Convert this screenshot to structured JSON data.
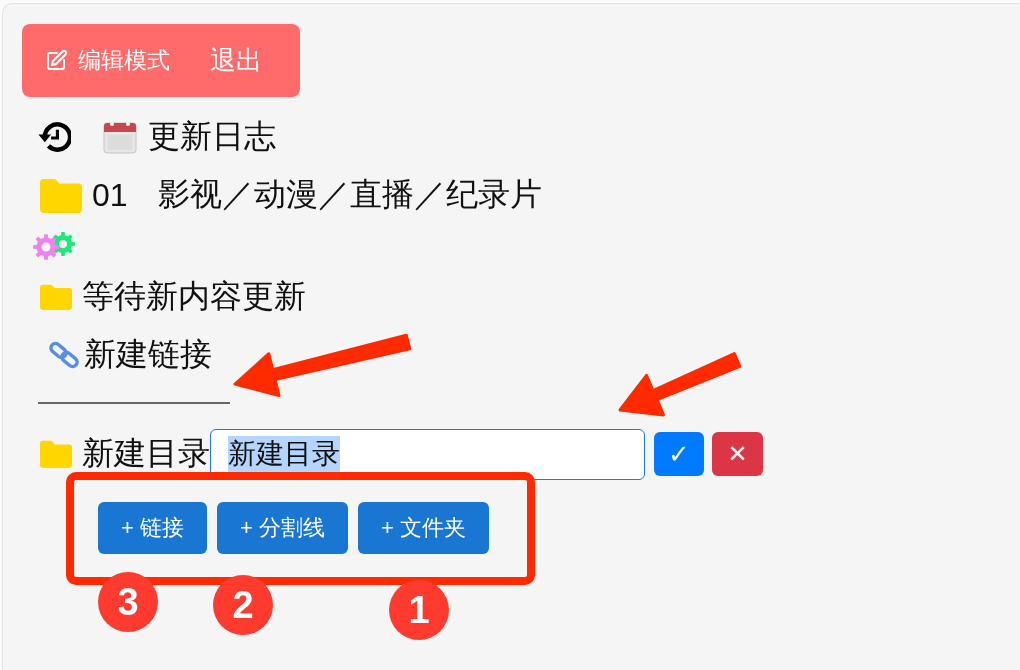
{
  "edit_bar": {
    "mode_label": "编辑模式",
    "exit": "退出"
  },
  "tree": [
    {
      "kind": "log",
      "label": "更新日志"
    },
    {
      "kind": "folder",
      "number": "01",
      "label": "影视／动漫／直播／纪录片"
    },
    {
      "kind": "settings"
    },
    {
      "kind": "folder",
      "label": "等待新内容更新"
    },
    {
      "kind": "link",
      "label": "新建链接"
    },
    {
      "kind": "divider"
    },
    {
      "kind": "folder",
      "label": "新建目录",
      "editor": {
        "value": "新建目录",
        "text_selected": true,
        "confirm": "✓",
        "cancel": "✕"
      }
    }
  ],
  "add_buttons": [
    "+ 链接",
    "+ 分割线",
    "+ 文件夹"
  ],
  "annotations": {
    "numbers": [
      "3",
      "2",
      "1"
    ]
  }
}
